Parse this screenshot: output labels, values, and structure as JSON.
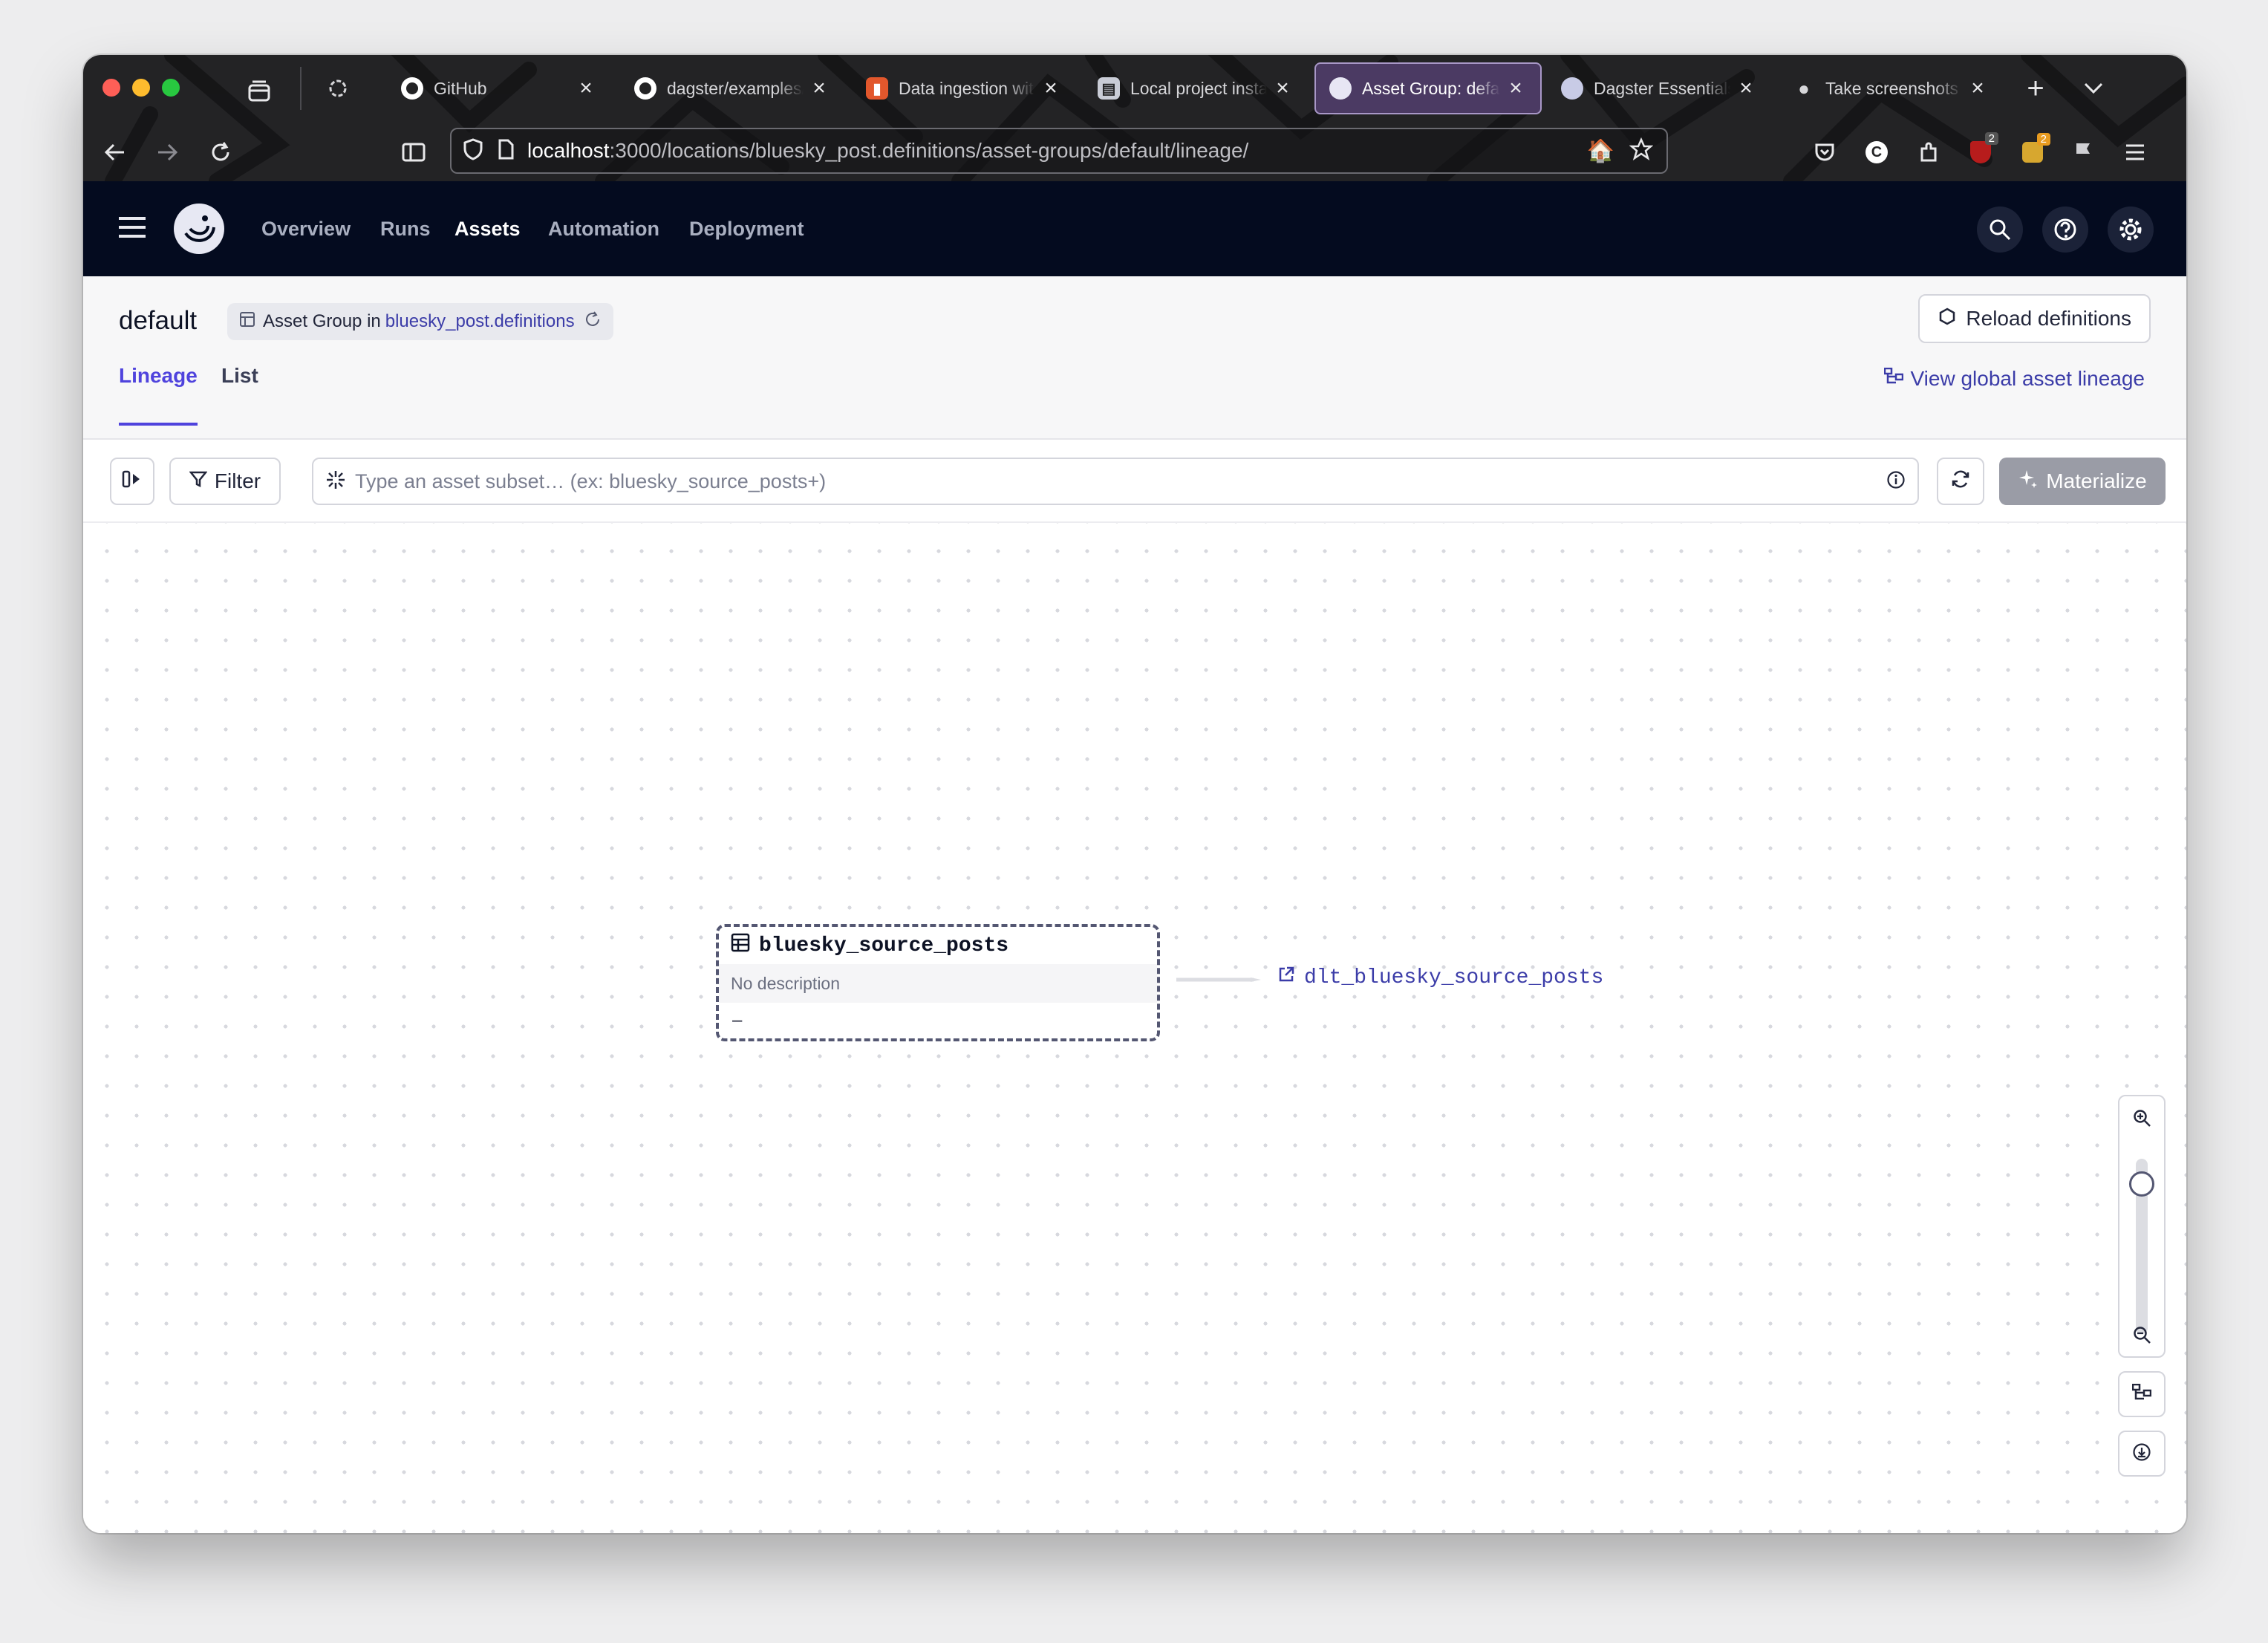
{
  "browser": {
    "tabs": [
      {
        "label": "",
        "icon": "openai-icon"
      },
      {
        "label": "GitHub",
        "icon": "github-icon"
      },
      {
        "label": "dagster/examples/",
        "icon": "github-icon"
      },
      {
        "label": "Data ingestion wit",
        "icon": "bookmark-icon"
      },
      {
        "label": "Local project insta",
        "icon": "docs-icon"
      },
      {
        "label": "Asset Group: defa",
        "icon": "dagster-icon",
        "active": true
      },
      {
        "label": "Dagster Essentials",
        "icon": "dagster-icon"
      },
      {
        "label": "Take screenshots",
        "icon": "apple-icon"
      }
    ],
    "url_host": "localhost",
    "url_path": ":3000/locations/bluesky_post.definitions/asset-groups/default/lineage/",
    "badge_counts": [
      "2",
      "2"
    ]
  },
  "app": {
    "nav": [
      "Overview",
      "Runs",
      "Assets",
      "Automation",
      "Deployment"
    ],
    "nav_selected": "Assets"
  },
  "page": {
    "title": "default",
    "crumb_prefix": "Asset Group in",
    "crumb_link": "bluesky_post.definitions",
    "reload_label": "Reload definitions",
    "tabs": [
      "Lineage",
      "List"
    ],
    "global_lineage_label": "View global asset lineage"
  },
  "toolbar": {
    "filter_label": "Filter",
    "search_placeholder": "Type an asset subset… (ex: bluesky_source_posts+)",
    "materialize_label": "Materialize"
  },
  "graph": {
    "node": {
      "name": "bluesky_source_posts",
      "description": "No description",
      "footer": "–"
    },
    "downstream_link": "dlt_bluesky_source_posts",
    "zoom_level": 0.25
  },
  "colors": {
    "accent": "#4f43dd",
    "nav_bg": "#040b1f",
    "link": "#3b3ca8"
  }
}
